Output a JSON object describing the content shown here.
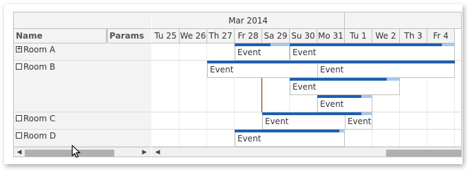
{
  "header": {
    "month_label": "Mar 2014",
    "columns": [
      {
        "label": "Name"
      },
      {
        "label": "Params"
      }
    ],
    "days": [
      "Tu 25",
      "We 26",
      "Th 27",
      "Fr 28",
      "Sa 29",
      "Su 30",
      "Mo 31",
      "Tu 1",
      "We 2",
      "Th 3",
      "Fr 4"
    ]
  },
  "rows": [
    {
      "label": "Room A",
      "expander": "+"
    },
    {
      "label": "Room B",
      "expander": ""
    },
    {
      "label": "Room C",
      "expander": ""
    },
    {
      "label": "Room D",
      "expander": ""
    }
  ],
  "events": [
    {
      "text": "Event",
      "row": "Room A",
      "start": "Fr 28",
      "end": "Sa 29",
      "progress": 0.65
    },
    {
      "text": "Event",
      "row": "Room A",
      "start": "Su 30",
      "end": "Fr 4",
      "progress": 0.92
    },
    {
      "text": "Event",
      "row": "Room B",
      "start": "Th 27",
      "end": "Mo 31",
      "progress": 1.0
    },
    {
      "text": "Event",
      "row": "Room B",
      "start": "Mo 31",
      "end": "Fr 4",
      "progress": 1.0
    },
    {
      "text": "Event",
      "row": "Room B",
      "start": "Su 30",
      "end": "We 2",
      "progress": 0.88
    },
    {
      "text": "Event",
      "row": "Room B",
      "start": "Mo 31",
      "end": "Tu 1",
      "progress": 0.8
    },
    {
      "text": "Event",
      "row": "Room C",
      "start": "Sa 29",
      "end": "Tu 1",
      "progress": 0.88
    },
    {
      "text": "Event",
      "row": "Room C",
      "start": "Tu 1",
      "end": "Tu 1",
      "progress": 0.6
    },
    {
      "text": "Event",
      "row": "Room D",
      "start": "Fr 28",
      "end": "Mo 31",
      "progress": 0.95
    }
  ],
  "colors": {
    "event_bar": "#1a5fb4",
    "event_bar_rest": "#a8c8e8",
    "now_line": "#aa0000",
    "header_bg": "#f3f3f3"
  },
  "icons": {
    "scroll_left": "◀",
    "scroll_right": "▶"
  }
}
